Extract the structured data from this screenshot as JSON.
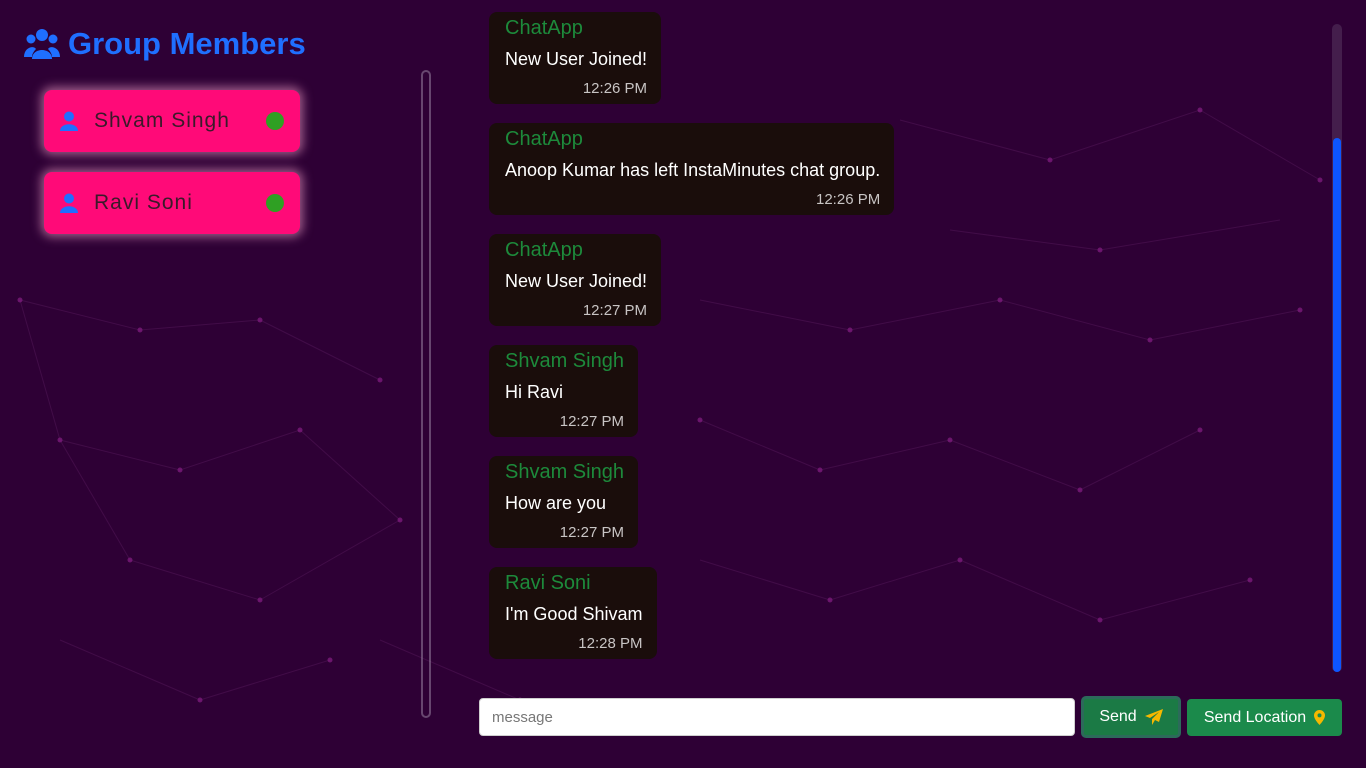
{
  "sidebar": {
    "title": "Group Members",
    "members": [
      {
        "name": "Shvam Singh",
        "status": "online"
      },
      {
        "name": "Ravi Soni",
        "status": "online"
      }
    ]
  },
  "messages": [
    {
      "sender": "ChatApp",
      "text": "New User Joined!",
      "time": "12:26 PM"
    },
    {
      "sender": "ChatApp",
      "text": "Anoop Kumar has left InstaMinutes chat group.",
      "time": "12:26 PM"
    },
    {
      "sender": "ChatApp",
      "text": "New User Joined!",
      "time": "12:27 PM"
    },
    {
      "sender": "Shvam Singh",
      "text": "Hi Ravi",
      "time": "12:27 PM"
    },
    {
      "sender": "Shvam Singh",
      "text": "How are you",
      "time": "12:27 PM"
    },
    {
      "sender": "Ravi Soni",
      "text": "I'm Good Shivam",
      "time": "12:28 PM"
    }
  ],
  "composer": {
    "placeholder": "message",
    "value": "",
    "send_label": "Send",
    "location_label": "Send Location"
  },
  "colors": {
    "background": "#2e0035",
    "accent_blue": "#1f6fff",
    "member_card": "#ff0a78",
    "online": "#2fa023",
    "sender_green": "#1d8a3b",
    "bubble": "#1a0d0b",
    "button_green": "#1b8a4b",
    "icon_yellow": "#f5b800"
  },
  "icons": {
    "title_icon": "users-icon",
    "member_icon": "user-icon",
    "send_icon": "paper-plane-icon",
    "location_icon": "map-marker-icon"
  }
}
